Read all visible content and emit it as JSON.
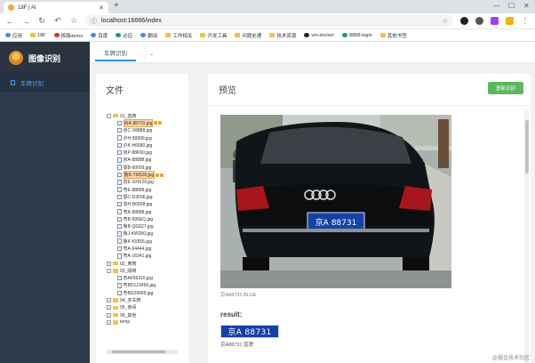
{
  "browser": {
    "tab_title": "18F | AI",
    "url": "localhost:16666/index",
    "bookmarks": [
      "应用",
      "18F",
      "极路demo",
      "百度",
      "必应",
      "翻译",
      "工作相关",
      "开发工具",
      "问题处理",
      "技术资源",
      "vm-docker",
      "8888-login",
      "其他书签"
    ]
  },
  "app": {
    "brand": "图像识别",
    "menu": [
      {
        "label": "车牌识别"
      }
    ],
    "nav_tab": "车牌识别"
  },
  "files": {
    "title": "文件",
    "tree": [
      {
        "type": "folder",
        "label": "01_蓝牌",
        "open": true,
        "level": 0
      },
      {
        "type": "file",
        "label": "京A·88731.jpg",
        "selected": true
      },
      {
        "type": "file",
        "label": "京C·X8888.jpg"
      },
      {
        "type": "file",
        "label": "沪H·99999.jpg"
      },
      {
        "type": "file",
        "label": "沪K·H6680.jpg"
      },
      {
        "type": "file",
        "label": "京P·88K60.jpg"
      },
      {
        "type": "file",
        "label": "京A·88888.jpg"
      },
      {
        "type": "file",
        "label": "鄂B·60009.jpg"
      },
      {
        "type": "file",
        "label": "鲁B·TM528.jpg",
        "selected": true
      },
      {
        "type": "file",
        "label": "苏E·GHX29.jpg"
      },
      {
        "type": "file",
        "label": "粤E·88888.jpg"
      },
      {
        "type": "file",
        "label": "鄂C·D3096.jpg"
      },
      {
        "type": "file",
        "label": "浙H·B6508.jpg"
      },
      {
        "type": "file",
        "label": "粤A·88888.jpg"
      },
      {
        "type": "file",
        "label": "粤B·995EQ.jpg"
      },
      {
        "type": "file",
        "label": "鲁B·QG527.jpg"
      },
      {
        "type": "file",
        "label": "鲁J·KW350.jpg"
      },
      {
        "type": "file",
        "label": "鲁K·K5555.jpg"
      },
      {
        "type": "file",
        "label": "粤A·64444.jpg"
      },
      {
        "type": "file",
        "label": "粤A·16341.jpg"
      },
      {
        "type": "folder",
        "label": "02_黄牌",
        "open": false,
        "level": 0
      },
      {
        "type": "folder",
        "label": "03_绿牌",
        "open": true,
        "level": 0
      },
      {
        "type": "file",
        "label": "苏AF66316.jpg"
      },
      {
        "type": "file",
        "label": "粤BD123456.jpg"
      },
      {
        "type": "file",
        "label": "粤BD29099.jpg"
      },
      {
        "type": "folder",
        "label": "04_多车牌",
        "open": false,
        "level": 0
      },
      {
        "type": "folder",
        "label": "05_夜间",
        "open": false,
        "level": 0
      },
      {
        "type": "folder",
        "label": "99_其他",
        "open": false,
        "level": 0
      },
      {
        "type": "folder",
        "label": "temp",
        "open": false,
        "level": 0
      }
    ]
  },
  "preview": {
    "title": "预览",
    "button": "重新识别",
    "caption": "京A88731 BLUE",
    "result_label": "result:",
    "plate_text": "京A 88731",
    "result_text": "京A88731 蓝牌"
  },
  "watermark": "@掘金技术社区",
  "colors": {
    "sidebar": "#2f3b4b",
    "accent": "#4ea1f3",
    "button": "#5cb85c",
    "plate": "#1640a8"
  }
}
